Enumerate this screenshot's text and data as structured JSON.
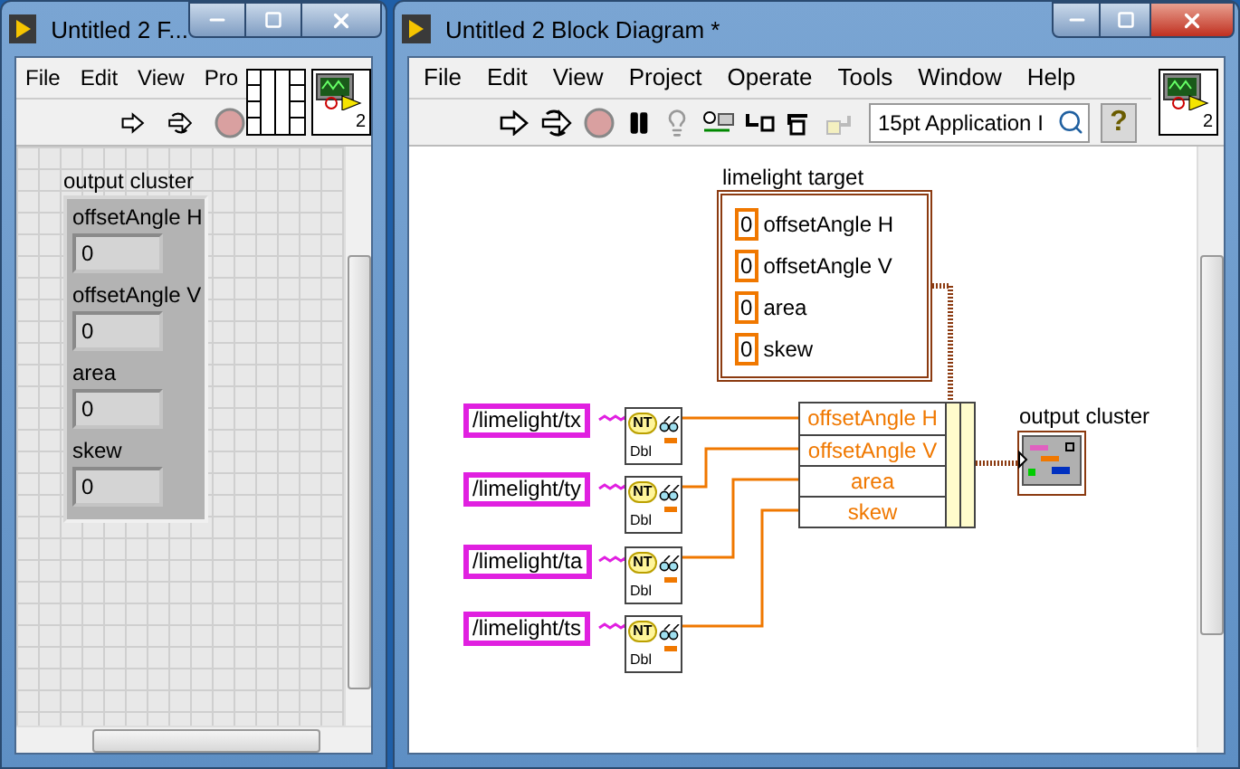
{
  "front_panel": {
    "title": "Untitled 2 F...",
    "menu": [
      "File",
      "Edit",
      "View",
      "Pro"
    ],
    "connector_number": "2",
    "cluster": {
      "label": "output cluster",
      "fields": [
        {
          "label": "offsetAngle H",
          "value": "0"
        },
        {
          "label": "offsetAngle V",
          "value": "0"
        },
        {
          "label": "area",
          "value": "0"
        },
        {
          "label": "skew",
          "value": "0"
        }
      ]
    }
  },
  "block_diagram": {
    "title": "Untitled 2 Block Diagram *",
    "menu": [
      "File",
      "Edit",
      "View",
      "Project",
      "Operate",
      "Tools",
      "Window",
      "Help"
    ],
    "font_selector": "15pt Application I",
    "help_button": "?",
    "connector_number": "2",
    "target": {
      "label": "limelight target",
      "fields": [
        {
          "value": "0",
          "label": "offsetAngle H"
        },
        {
          "value": "0",
          "label": "offsetAngle V"
        },
        {
          "value": "0",
          "label": "area"
        },
        {
          "value": "0",
          "label": "skew"
        }
      ]
    },
    "paths": [
      {
        "text": "/limelight/tx",
        "node_top": "NT",
        "node_bottom": "Dbl"
      },
      {
        "text": "/limelight/ty",
        "node_top": "NT",
        "node_bottom": "Dbl"
      },
      {
        "text": "/limelight/ta",
        "node_top": "NT",
        "node_bottom": "Dbl"
      },
      {
        "text": "/limelight/ts",
        "node_top": "NT",
        "node_bottom": "Dbl"
      }
    ],
    "bundle": [
      "offsetAngle H",
      "offsetAngle V",
      "area",
      "skew"
    ],
    "indicator": {
      "label": "output cluster"
    }
  }
}
